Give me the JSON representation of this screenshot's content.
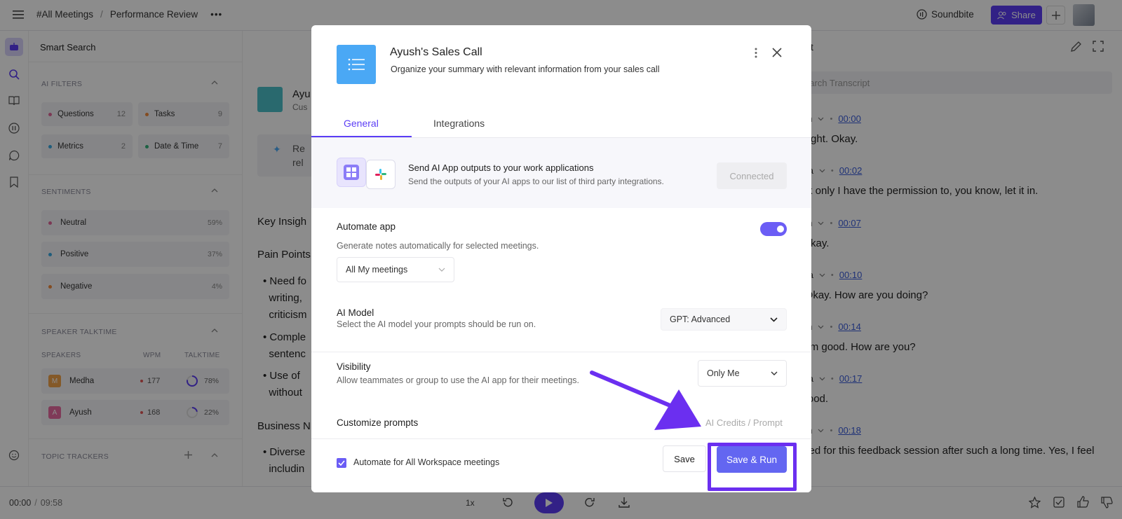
{
  "breadcrumb": {
    "root": "#All Meetings",
    "separator": "/",
    "current": "Performance Review"
  },
  "topbar": {
    "soundbite_label": "Soundbite",
    "share_label": "Share"
  },
  "smart_search": {
    "title": "Smart Search",
    "ai_filters": {
      "label": "AI FILTERS",
      "chips": [
        {
          "label": "Questions",
          "count": "12",
          "color": "#e0679a"
        },
        {
          "label": "Tasks",
          "count": "9",
          "color": "#f08a3c"
        },
        {
          "label": "Metrics",
          "count": "2",
          "color": "#3aa8e0"
        },
        {
          "label": "Date & Time",
          "count": "7",
          "color": "#33b37a"
        }
      ]
    },
    "sentiments": {
      "label": "SENTIMENTS",
      "items": [
        {
          "label": "Neutral",
          "pct": "59%",
          "color": "#e0679a"
        },
        {
          "label": "Positive",
          "pct": "37%",
          "color": "#3aa8e0"
        },
        {
          "label": "Negative",
          "pct": "4%",
          "color": "#f08a3c"
        }
      ]
    },
    "talktime": {
      "label": "SPEAKER TALKTIME",
      "col_speakers": "SPEAKERS",
      "col_wpm": "WPM",
      "col_talktime": "TALKTIME",
      "speakers": [
        {
          "initial": "M",
          "name": "Medha",
          "wpm": "177",
          "pct": "78%",
          "fraction": 0.78,
          "color": "#f0a24a"
        },
        {
          "initial": "A",
          "name": "Ayush",
          "wpm": "168",
          "pct": "22%",
          "fraction": 0.22,
          "color": "#e86aa0"
        }
      ]
    },
    "topic_trackers": {
      "label": "TOPIC TRACKERS"
    }
  },
  "main": {
    "heading_partial": "Ayu",
    "sub_partial": "Cus",
    "tip_line1": "Re",
    "tip_line2": "rel",
    "key_insights": "Key Insigh",
    "pain_points": "Pain Points",
    "bullets": [
      {
        "l1": "Need fo",
        "l2": "writing,",
        "l3": "criticism"
      },
      {
        "l1": "Comple",
        "l2": "sentenc",
        "l3": ""
      },
      {
        "l1": "Use of",
        "l2": "without",
        "l3": ""
      }
    ],
    "business": "Business N",
    "bullet4_l1": "Diverse",
    "bullet4_l2": "includin"
  },
  "transcript": {
    "title_partial": "ript",
    "search_placeholder": "earch Transcript",
    "entries": [
      {
        "name": "yush",
        "time": "00:00",
        "text": "h, right. Okay."
      },
      {
        "name": "edha",
        "time": "00:02",
        "text": "hink only I have the permission to, you know, let it in."
      },
      {
        "name": "yush",
        "time": "00:07",
        "text": "h, okay."
      },
      {
        "name": "edha",
        "time": "00:10",
        "text": "o. Okay. How are you doing?"
      },
      {
        "name": "yush",
        "time": "00:14",
        "text": "n. I'm good. How are you?"
      },
      {
        "name": "edha",
        "time": "00:17",
        "text": "n good."
      },
      {
        "name": "yush",
        "time": "00:18",
        "text": "xcited for this feedback session after such a long time. Yes, I feel"
      }
    ]
  },
  "player": {
    "current": "00:00",
    "separator": "/",
    "total": "09:58",
    "speed": "1x"
  },
  "modal": {
    "title": "Ayush's Sales Call",
    "subtitle": "Organize your summary with relevant information from your sales call",
    "tabs": [
      {
        "label": "General",
        "active": true
      },
      {
        "label": "Integrations",
        "active": false
      }
    ],
    "integrations_card": {
      "title": "Send AI App outputs to your work applications",
      "subtitle": "Send the outputs of your AI apps to our list of third party integrations.",
      "button": "Connected"
    },
    "automate": {
      "label": "Automate app",
      "description": "Generate notes automatically for selected meetings.",
      "enabled": true,
      "meetings_select": "All My meetings"
    },
    "ai_model": {
      "label": "AI Model",
      "description": "Select the AI model your prompts should be run on.",
      "value": "GPT: Advanced"
    },
    "visibility": {
      "label": "Visibility",
      "description": "Allow teammates or group to use the AI app for their meetings.",
      "value": "Only Me"
    },
    "customize": {
      "label": "Customize prompts",
      "credits": "AI Credits / Prompt"
    },
    "footer": {
      "checkbox_label": "Automate for All Workspace meetings",
      "checked": true,
      "save": "Save",
      "save_run": "Save & Run"
    }
  },
  "colors": {
    "accent": "#5b3df5",
    "button": "#6366f1",
    "annotation": "#6b2ff0"
  }
}
